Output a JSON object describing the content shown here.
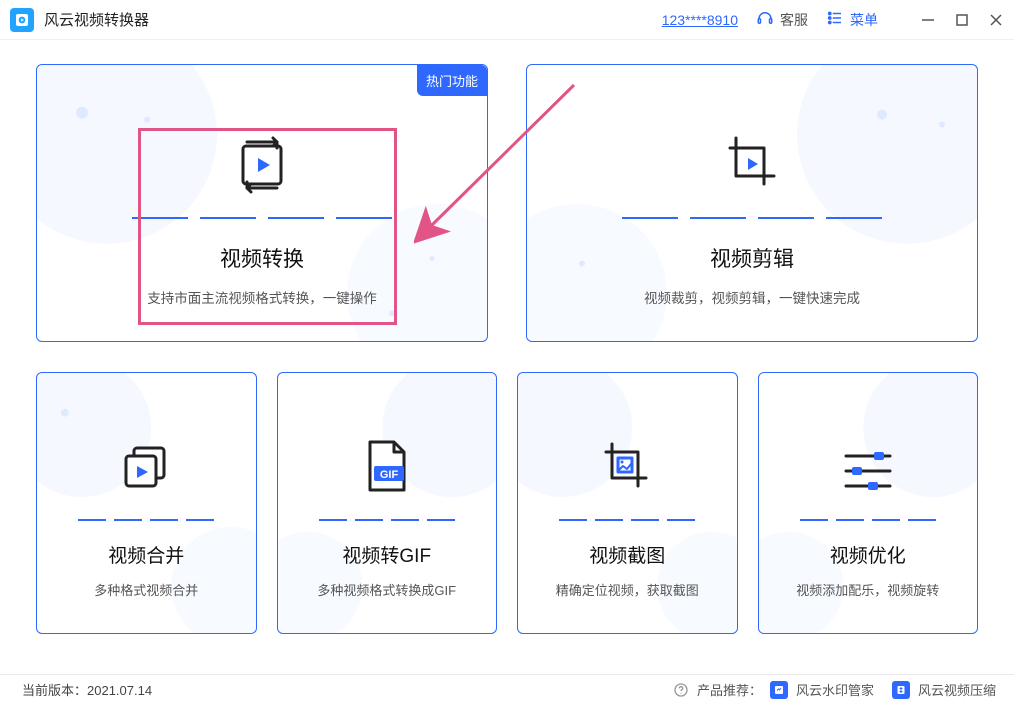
{
  "titlebar": {
    "app_name": "风云视频转换器",
    "user_id": "123****8910",
    "service": "客服",
    "menu": "菜单"
  },
  "cards": {
    "video_convert": {
      "badge": "热门功能",
      "title": "视频转换",
      "desc": "支持市面主流视频格式转换，一键操作"
    },
    "video_edit": {
      "title": "视频剪辑",
      "desc": "视频裁剪，视频剪辑，一键快速完成"
    },
    "video_merge": {
      "title": "视频合并",
      "desc": "多种格式视频合并"
    },
    "video_gif": {
      "title": "视频转GIF",
      "desc": "多种视频格式转换成GIF",
      "gif_label": "GIF"
    },
    "video_capture": {
      "title": "视频截图",
      "desc": "精确定位视频，获取截图"
    },
    "video_optimize": {
      "title": "视频优化",
      "desc": "视频添加配乐，视频旋转"
    }
  },
  "footer": {
    "version_label": "当前版本：",
    "version": "2021.07.14",
    "recommend_label": "产品推荐：",
    "rec1": "风云水印管家",
    "rec2": "风云视频压缩"
  }
}
